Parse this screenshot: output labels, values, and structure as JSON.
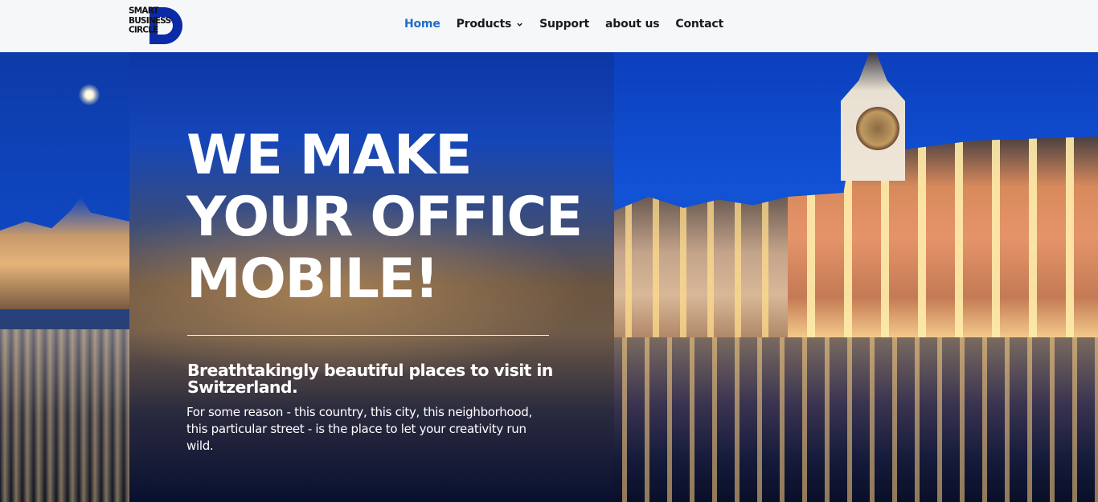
{
  "header": {
    "logo": {
      "lines": [
        "SMART",
        "BUSINESS",
        "CIRCLE"
      ],
      "accent_color": "#0a2aa8"
    },
    "nav": [
      {
        "label": "Home",
        "active": true
      },
      {
        "label": "Products",
        "has_dropdown": true
      },
      {
        "label": "Support"
      },
      {
        "label": "about us"
      },
      {
        "label": "Contact"
      }
    ],
    "active_color": "#1f6cc4"
  },
  "hero": {
    "title_lines": [
      "WE MAKE",
      "YOUR OFFICE",
      "MOBILE!"
    ],
    "subtitle": "Breathtakingly beautiful places to visit in Switzerland.",
    "body": "For some reason - this country, this city, this neighborhood, this particular street - is the place to let your creativity run wild."
  }
}
